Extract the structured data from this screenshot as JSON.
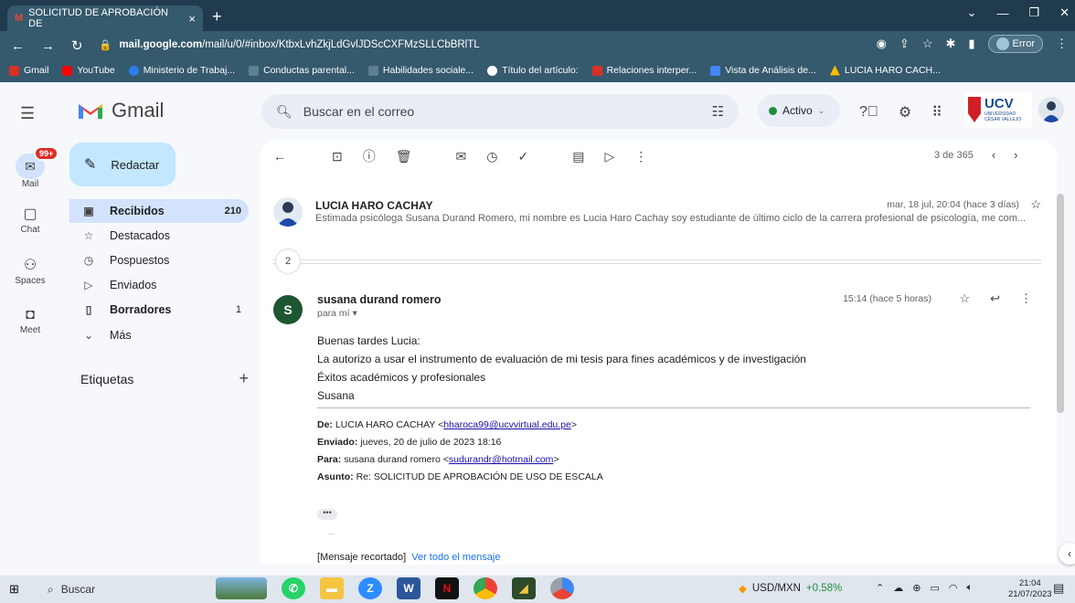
{
  "browser": {
    "tab_title": "SOLICITUD DE APROBACIÓN DE",
    "tab_close": "×",
    "new_tab": "+",
    "url_host": "mail.google.com",
    "url_path": "/mail/u/0/#inbox/KtbxLvhZkjLdGvlJDScCXFMzSLLCbBRlTL",
    "error_label": "Error",
    "bookmarks": [
      {
        "label": "Gmail",
        "color": "#d93025"
      },
      {
        "label": "YouTube",
        "color": "#ff0000"
      },
      {
        "label": "Ministerio de Trabaj...",
        "color": "#2b7de9"
      },
      {
        "label": "Conductas parental...",
        "color": "#8ab4f8"
      },
      {
        "label": "Habilidades sociale...",
        "color": "#8ab4f8"
      },
      {
        "label": "Título del artículo:",
        "color": "#202124"
      },
      {
        "label": "Relaciones interper...",
        "color": "#d93025"
      },
      {
        "label": "Vista de Análisis de...",
        "color": "#4285f4"
      },
      {
        "label": "LUCIA HARO CACH...",
        "color": "#fbbc04"
      }
    ]
  },
  "gmail": {
    "logo_text": "Gmail",
    "search_placeholder": "Buscar en el correo",
    "status": "Activo",
    "ucv_logo": "UCV",
    "ucv_sub": "UNIVERSIDAD CÉSAR VALLEJO",
    "rail": {
      "mail": "Mail",
      "mail_badge": "99+",
      "chat": "Chat",
      "spaces": "Spaces",
      "meet": "Meet"
    },
    "compose": "Redactar",
    "nav": [
      {
        "label": "Recibidos",
        "count": "210"
      },
      {
        "label": "Destacados",
        "count": ""
      },
      {
        "label": "Pospuestos",
        "count": ""
      },
      {
        "label": "Enviados",
        "count": ""
      },
      {
        "label": "Borradores",
        "count": "1"
      },
      {
        "label": "Más",
        "count": ""
      }
    ],
    "labels_title": "Etiquetas",
    "pager": "3 de 365"
  },
  "thread": {
    "msg1": {
      "from": "LUCIA HARO CACHAY",
      "date": "mar, 18 jul, 20:04 (hace 3 días)",
      "snippet": "Estimada psicóloga Susana Durand Romero, mi nombre es Lucia Haro Cachay soy estudiante de último ciclo de la carrera profesional de psicología, me com..."
    },
    "collapsed_count": "2",
    "msg2": {
      "avatar_letter": "S",
      "from": "susana durand romero",
      "to": "para mí",
      "date": "15:14 (hace 5 horas)",
      "body": [
        "Buenas tardes Lucia:",
        "La autorizo a usar el instrumento de evaluación de mi tesis para fines académicos y de investigación",
        "Éxitos académicos y profesionales",
        "Susana"
      ],
      "quote": {
        "de_label": "De:",
        "de_name": "LUCIA HARO CACHAY <",
        "de_email": "hharoca99@ucvvirtual.edu.pe",
        "de_close": ">",
        "enviado_label": "Enviado:",
        "enviado": "jueves, 20 de julio de 2023 18:16",
        "para_label": "Para:",
        "para_name": "susana durand romero <",
        "para_email": "sudurandr@hotmail.com",
        "para_close": ">",
        "asunto_label": "Asunto:",
        "asunto": "Re: SOLICITUD DE APROBACIÓN DE USO DE ESCALA"
      },
      "dots": "•••",
      "small_dots": "...",
      "truncated": "[Mensaje recortado]",
      "view_all": "Ver todo el mensaje"
    }
  },
  "taskbar": {
    "search": "Buscar",
    "ticker_label": "USD/MXN",
    "ticker_pct": "+0.58%",
    "time": "21:04",
    "date": "21/07/2023"
  }
}
